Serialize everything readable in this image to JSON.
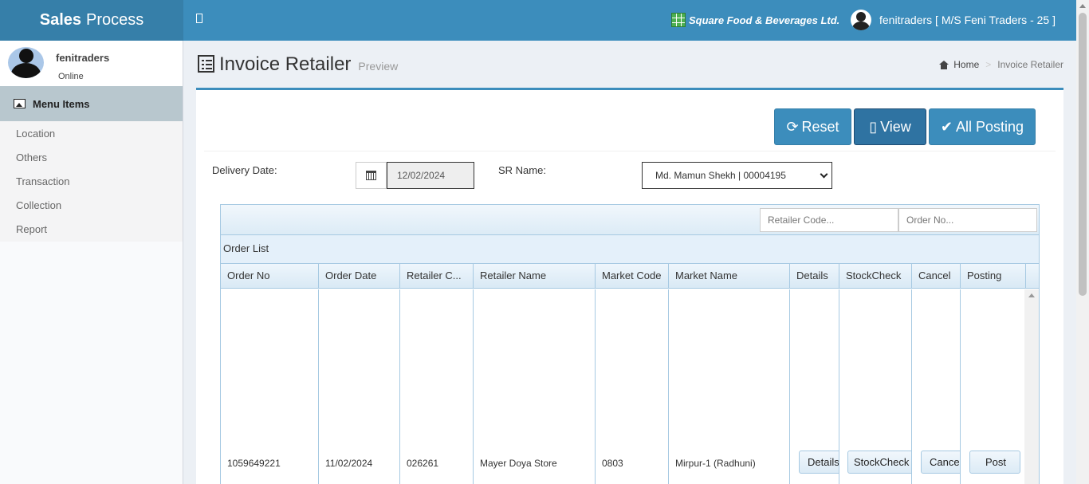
{
  "header": {
    "brand_bold": "Sales",
    "brand_rest": "Process",
    "company": "Square Food & Beverages Ltd.",
    "user": "fenitraders [ M/S Feni Traders - 25 ]"
  },
  "sidebar": {
    "user_name": "fenitraders",
    "user_status": "Online",
    "menu_header": "Menu Items",
    "items": [
      {
        "label": "Location"
      },
      {
        "label": "Others"
      },
      {
        "label": "Transaction"
      },
      {
        "label": "Collection"
      },
      {
        "label": "Report"
      }
    ]
  },
  "page": {
    "title": "Invoice Retailer",
    "subtitle": "Preview",
    "breadcrumb": {
      "home": "Home",
      "current": "Invoice Retailer"
    }
  },
  "toolbar": {
    "reset_label": "Reset",
    "view_label": "View",
    "all_posting_label": "All Posting"
  },
  "form": {
    "delivery_date_label": "Delivery Date:",
    "delivery_date_value": "12/02/2024",
    "sr_name_label": "SR Name:",
    "sr_name_value": "Md. Mamun Shekh | 00004195"
  },
  "grid": {
    "retailer_code_placeholder": "Retailer Code...",
    "order_no_placeholder": "Order No...",
    "caption": "Order List",
    "columns": [
      "Order No",
      "Order Date",
      "Retailer C...",
      "Retailer Name",
      "Market Code",
      "Market Name",
      "Details",
      "StockCheck",
      "Cancel",
      "Posting"
    ],
    "rows": [
      {
        "order_no": "1059649221",
        "order_date": "11/02/2024",
        "retailer_code": "026261",
        "retailer_name": "Mayer Doya Store",
        "market_code": "0803",
        "market_name": "Mirpur-1 (Radhuni)",
        "details_btn": "Details",
        "stockcheck_btn": "StockCheck",
        "cancel_btn": "Cancel",
        "posting_btn": "Post"
      }
    ]
  },
  "colors": {
    "header_bg": "#3c8dbc",
    "brand_bg": "#367fa9",
    "sidebar_header_bg": "#b8c7ce",
    "grid_border": "#a6c9e2"
  }
}
